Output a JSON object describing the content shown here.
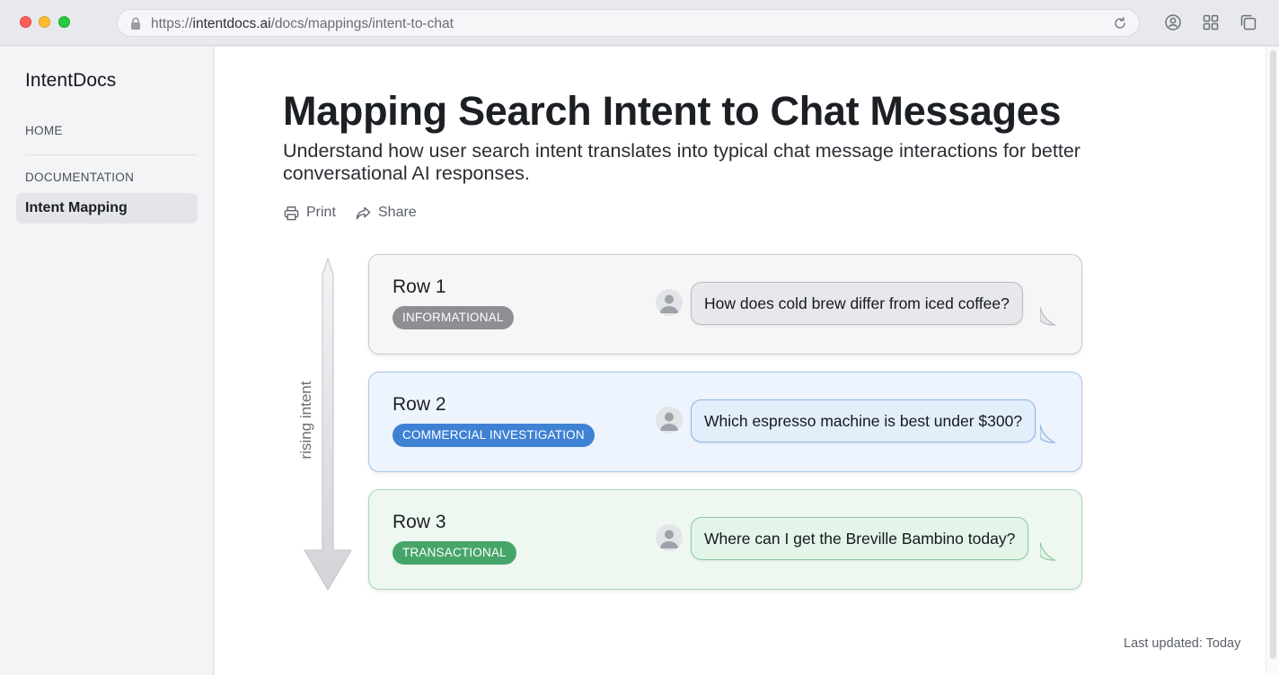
{
  "browser": {
    "url_prefix": "https://",
    "url_host": "intentdocs.ai",
    "url_path": "/docs/mappings/intent-to-chat",
    "icons": [
      "lock-icon",
      "reload-icon",
      "account-icon",
      "extensions-grid-icon",
      "tabs-overview-icon"
    ]
  },
  "sidebar": {
    "brand": "IntentDocs",
    "home": "HOME",
    "section": "DOCUMENTATION",
    "active_item": "Intent Mapping"
  },
  "page": {
    "title": "Mapping Search Intent to Chat Messages",
    "lede": "Understand how user search intent translates into typical chat message interactions for better conversational AI responses.",
    "actions": {
      "print": "Print",
      "share": "Share"
    },
    "axis_label": "rising intent",
    "rows": [
      {
        "label": "Row 1",
        "intent": "INFORMATIONAL",
        "message": "How does cold brew differ from iced coffee?",
        "badge_color": "#8d8f93",
        "bubble_bg": "#e7e8eb",
        "bubble_border": "#b9bcc2"
      },
      {
        "label": "Row 2",
        "intent": "COMMERCIAL INVESTIGATION",
        "message": "Which espresso machine is best under $300?",
        "badge_color": "#3f82d4",
        "bubble_bg": "#e3eefb",
        "bubble_border": "#8fb4e3"
      },
      {
        "label": "Row 3",
        "intent": "TRANSACTIONAL",
        "message": "Where can I get the Breville Bambino today?",
        "badge_color": "#47a56a",
        "bubble_bg": "#e3f4e8",
        "bubble_border": "#8fcaa2"
      }
    ],
    "footer": "Last updated: Today"
  }
}
